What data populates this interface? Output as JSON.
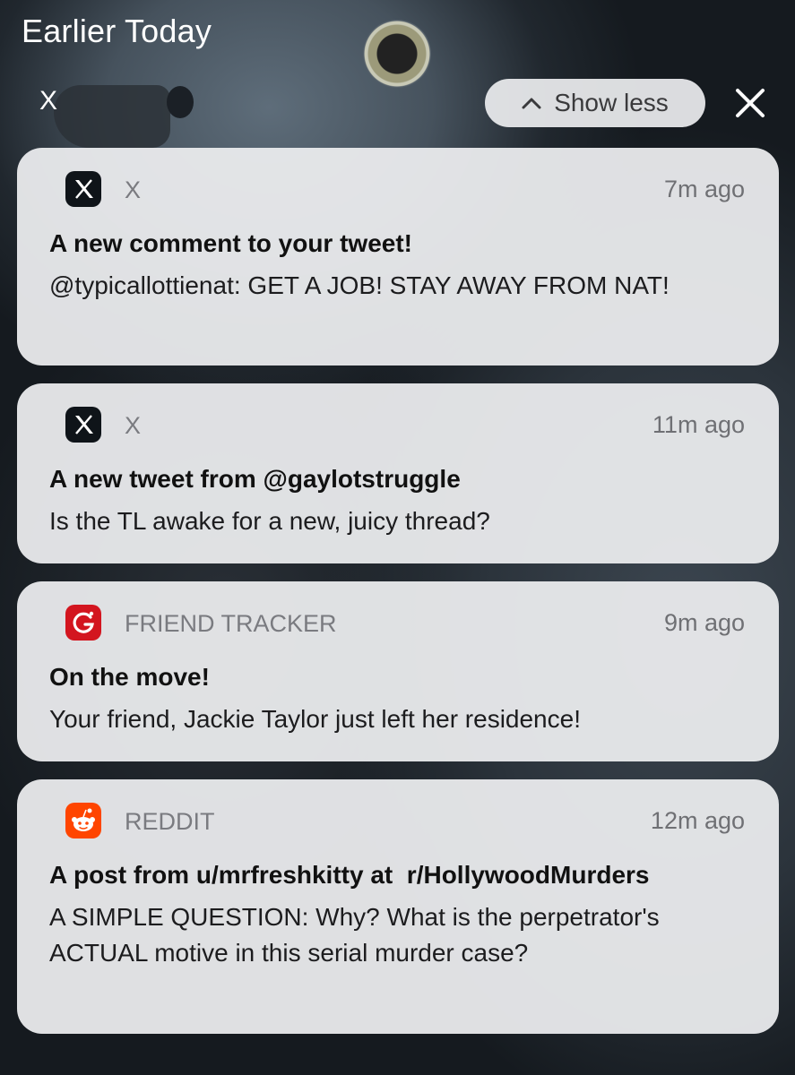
{
  "header": {
    "title": "Earlier Today",
    "clear_label": "X",
    "show_less_label": "Show less"
  },
  "notifications": [
    {
      "app": "X",
      "time": "7m ago",
      "title": "A new comment to your tweet!",
      "body": "@typicallottienat: GET A JOB! STAY AWAY FROM NAT!"
    },
    {
      "app": "X",
      "time": "11m ago",
      "title": "A new tweet from @gaylotstruggle",
      "body": "Is the TL awake for a new, juicy thread?"
    },
    {
      "app": "FRIEND TRACKER",
      "time": "9m ago",
      "title": "On the move!",
      "body": "Your friend, Jackie Taylor just left her residence!"
    },
    {
      "app": "REDDIT",
      "time": "12m ago",
      "title": "A post from u/mrfreshkitty at  r/HollywoodMurders",
      "body": "A SIMPLE QUESTION: Why? What is the perpetrator's ACTUAL motive in this serial murder case?"
    }
  ],
  "icons": {
    "x_app": "x-logo-icon",
    "friend_tracker": "friend-tracker-icon",
    "reddit": "reddit-icon",
    "close": "close-icon",
    "chevron": "chevron-up-icon"
  },
  "colors": {
    "x_brand": "#0f1419",
    "friend_tracker_brand": "#d3151f",
    "reddit_brand": "#ff4500"
  }
}
